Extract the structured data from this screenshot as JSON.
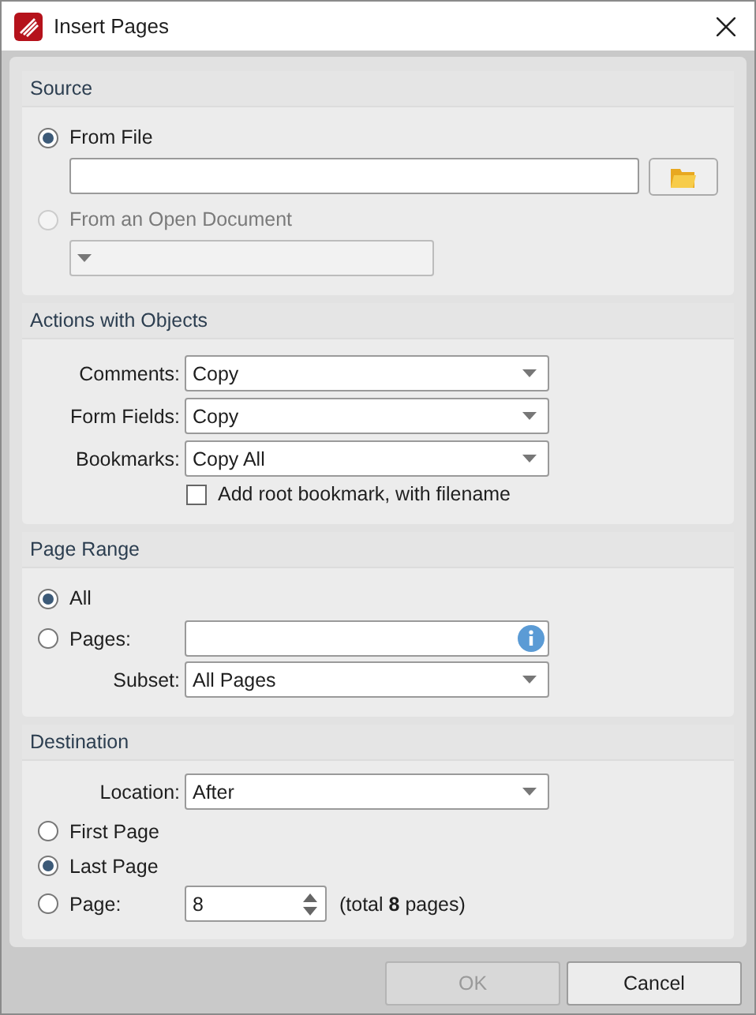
{
  "window": {
    "title": "Insert Pages"
  },
  "source": {
    "title": "Source",
    "options": [
      {
        "label": "From File",
        "selected": true,
        "disabled": false,
        "kind": "file"
      },
      {
        "label": "From an Open Document",
        "selected": false,
        "disabled": true,
        "kind": "dropdown"
      }
    ]
  },
  "actions": {
    "title": "Actions with Objects",
    "dropdowns": [
      {
        "label": "Comments:",
        "value": "Copy"
      },
      {
        "label": "Form Fields:",
        "value": "Copy"
      },
      {
        "label": "Bookmarks:",
        "value": "Copy All"
      }
    ],
    "checkbox": {
      "label": "Add root bookmark, with filename",
      "checked": false
    }
  },
  "page_range": {
    "title": "Page Range",
    "options": [
      {
        "label": "All",
        "selected": true,
        "kind": "plain"
      },
      {
        "label": "Pages:",
        "selected": false,
        "kind": "field"
      }
    ],
    "subset": {
      "label": "Subset:",
      "value": "All Pages"
    }
  },
  "destination": {
    "title": "Destination",
    "location": {
      "label": "Location:",
      "value": "After"
    },
    "options": [
      {
        "label": "First Page",
        "selected": false,
        "kind": "plain"
      },
      {
        "label": "Last Page",
        "selected": true,
        "kind": "plain"
      },
      {
        "label": "Page:",
        "selected": false,
        "kind": "spinner",
        "value": "8",
        "note": "(total **8** pages)"
      }
    ]
  },
  "buttons": [
    {
      "label": "OK",
      "disabled": true
    },
    {
      "label": "Cancel",
      "disabled": false
    }
  ]
}
